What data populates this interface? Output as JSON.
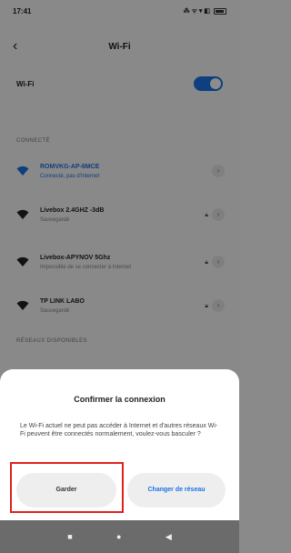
{
  "status_bar": {
    "time": "17:41",
    "icons": "⁂ ᯤ ▾ ◧",
    "battery": ""
  },
  "header": {
    "back_icon": "‹",
    "title": "Wi-Fi"
  },
  "wifi_toggle": {
    "label": "Wi-Fi",
    "enabled": true
  },
  "sections": {
    "connected": "CONNECTÉ",
    "available": "RÉSEAUX DISPONIBLES"
  },
  "networks": [
    {
      "name": "ROMVKG-AP-6MCE",
      "subtitle": "Connecté, pas d'Internet",
      "connected": true,
      "locked": false
    },
    {
      "name": "Livebox 2.4GHZ -3dB",
      "subtitle": "Sauvegardé",
      "connected": false,
      "locked": true
    },
    {
      "name": "Livebox-APYNOV 5Ghz",
      "subtitle": "Impossible de se connecter à Internet",
      "connected": false,
      "locked": true
    },
    {
      "name": "TP LINK LABO",
      "subtitle": "Sauvegardé",
      "connected": false,
      "locked": true
    }
  ],
  "dialog": {
    "title": "Confirmer la connexion",
    "body": "Le Wi-Fi actuel ne peut pas accéder à Internet et d'autres réseaux Wi-Fi peuvent être connectés normalement, voulez-vous basculer ?",
    "keep_label": "Garder",
    "change_label": "Changer de réseau"
  },
  "navbar": {
    "recent": "■",
    "home": "●",
    "back": "◀"
  },
  "colors": {
    "accent": "#1a73e8",
    "highlight": "#e02020"
  }
}
